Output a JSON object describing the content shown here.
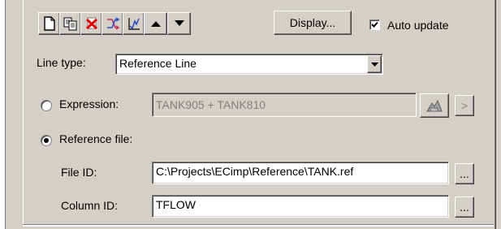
{
  "toolbar": {
    "icons": [
      "new-icon",
      "copy-icon",
      "delete-icon",
      "shuffle-icon",
      "plot-icon",
      "move-up-icon",
      "move-down-icon"
    ],
    "display_label": "Display...",
    "auto_update_label": "Auto update",
    "auto_update_checked": true
  },
  "line_type": {
    "label": "Line type:",
    "value": "Reference Line"
  },
  "expression": {
    "label": "Expression:",
    "value": "TANK905 + TANK810",
    "selected": false
  },
  "reference_file": {
    "label": "Reference file:",
    "selected": true,
    "file_id_label": "File ID:",
    "file_id_value": "C:\\Projects\\ECimp\\Reference\\TANK.ref",
    "column_id_label": "Column ID:",
    "column_id_value": "TFLOW",
    "browse_label": "..."
  },
  "arrow_label": ">"
}
